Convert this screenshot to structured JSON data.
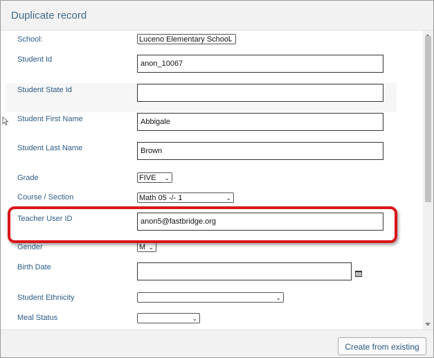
{
  "dialog": {
    "title": "Duplicate record",
    "create_button_label": "Create from existing"
  },
  "fields": {
    "school": {
      "label": "School:",
      "value": "Luceno Elementary School"
    },
    "student_id": {
      "label": "Student Id",
      "value": "anon_10067"
    },
    "student_state_id": {
      "label": "Student State Id",
      "value": ""
    },
    "first_name": {
      "label": "Student First Name",
      "value": "Abbigale"
    },
    "last_name": {
      "label": "Student Last Name",
      "value": "Brown"
    },
    "grade": {
      "label": "Grade",
      "value": "FIVE"
    },
    "course_section": {
      "label": "Course / Section",
      "value": "Math 05 -/- 1"
    },
    "teacher_user_id": {
      "label": "Teacher User ID",
      "value": "anon5@fastbridge.org"
    },
    "gender": {
      "label": "Gender",
      "value": "M"
    },
    "birth_date": {
      "label": "Birth Date",
      "value": ""
    },
    "ethnicity": {
      "label": "Student Ethnicity",
      "value": ""
    },
    "meal_status": {
      "label": "Meal Status",
      "value": ""
    }
  },
  "colors": {
    "label": "#2a5b86",
    "highlight": "#d9151b",
    "title": "#3e6b8c"
  },
  "icons": {
    "calendar": "calendar-icon",
    "dropdown": "chevron-down-icon"
  }
}
